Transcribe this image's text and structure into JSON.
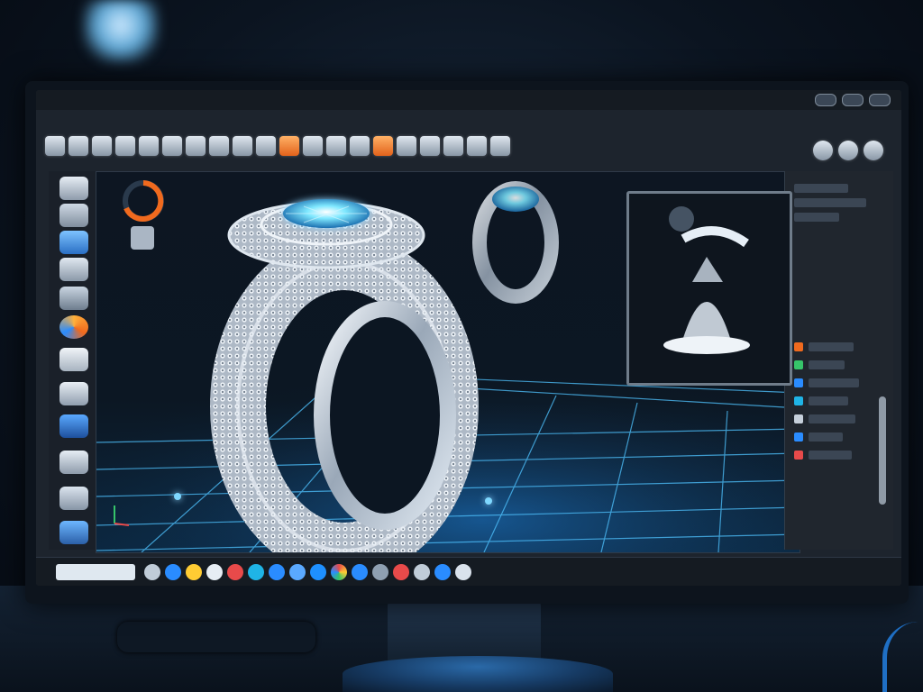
{
  "window": {
    "menu_text": "",
    "status_left": "",
    "status_center": "",
    "tray_text": ""
  },
  "left_panel": {
    "widget_label": ""
  },
  "colors": {
    "accent_blue": "#2a8cff",
    "accent_orange": "#f06a1e",
    "grid": "#4fc3ff",
    "gem": "#7fe8ff"
  },
  "toolbar": {
    "left_icons": [
      "select-icon",
      "move-icon",
      "rotate-icon",
      "scale-icon",
      "cube-icon",
      "sphere-icon",
      "mirror-icon",
      "array-icon",
      "torus-icon",
      "sweep-icon",
      "loft-icon",
      "shell-icon",
      "gem-icon",
      "prong-icon",
      "render-icon",
      "material-icon",
      "light-icon",
      "camera-icon",
      "measure-icon",
      "export-icon"
    ],
    "right_icons": [
      "view-icon",
      "shade-icon",
      "settings-icon"
    ]
  },
  "left_panel_icons": [
    "layers-icon",
    "pen-icon",
    "cloud-icon",
    "brush-icon",
    "chart-icon",
    "color-wheel-icon",
    "document-icon",
    "bell-icon",
    "globe-icon",
    "record-icon",
    "folder-icon",
    "help-icon"
  ],
  "taskbar_icons": [
    "app-icon-1",
    "app-icon-2",
    "app-icon-3",
    "app-icon-4",
    "app-icon-5",
    "app-icon-6",
    "app-icon-7",
    "app-icon-8",
    "app-icon-9",
    "app-icon-10",
    "app-icon-11",
    "app-icon-12",
    "app-icon-13",
    "app-icon-14",
    "app-icon-15",
    "app-icon-16"
  ]
}
